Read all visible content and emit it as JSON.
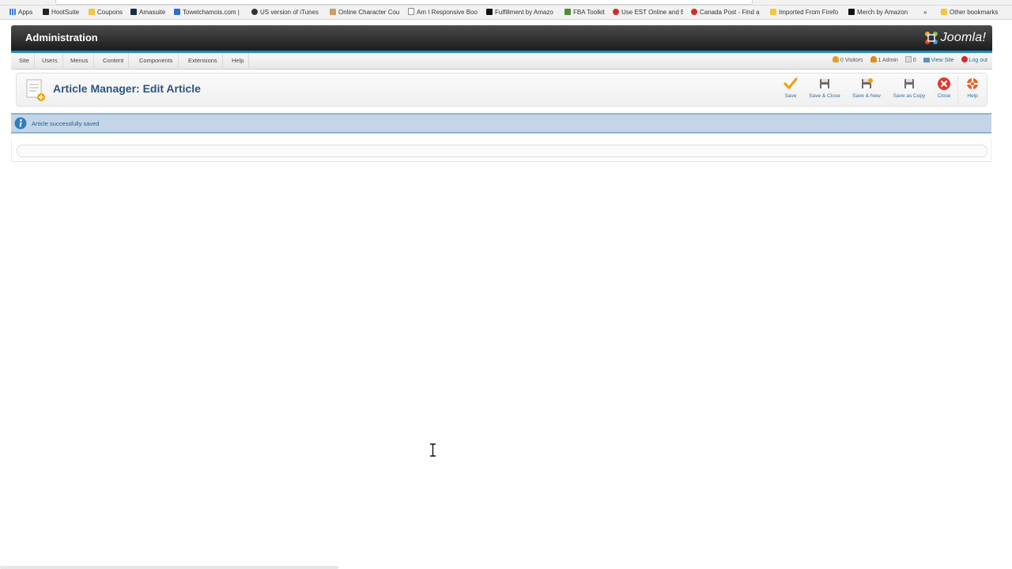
{
  "bookmarks": [
    {
      "label": "Apps",
      "color": "#3b7dd8"
    },
    {
      "label": "HootSuite",
      "color": "#222222"
    },
    {
      "label": "Coupons",
      "color": "#f4c542"
    },
    {
      "label": "Amasuite",
      "color": "#1a2b4c"
    },
    {
      "label": "Towelchamois.com |",
      "color": "#2a6fc9"
    },
    {
      "label": "US version of iTunes",
      "color": "#333333"
    },
    {
      "label": "Online Character Cou",
      "color": "#c8a060"
    },
    {
      "label": "Am I Responsive Boo",
      "color": "#888888"
    },
    {
      "label": "Fulfillment by Amazo",
      "color": "#111111"
    },
    {
      "label": "FBA Toolkit",
      "color": "#4a8f3c"
    },
    {
      "label": "Use EST Online and E",
      "color": "#d32a2a"
    },
    {
      "label": "Canada Post - Find a",
      "color": "#d32a2a"
    },
    {
      "label": "Imported From Firefo",
      "color": "#f4c542"
    },
    {
      "label": "Merch by Amazon",
      "color": "#111111"
    }
  ],
  "bookmarks_more": "»",
  "bookmarks_other": "Other bookmarks",
  "header": {
    "title": "Administration",
    "logo_text": "Joomla!"
  },
  "menu": [
    "Site",
    "Users",
    "Menus",
    "Content",
    "Components",
    "Extensions",
    "Help"
  ],
  "status": {
    "visitors": "0 Visitors",
    "admins": "1 Admin",
    "messages": "0",
    "view_site": "View Site",
    "logout": "Log out"
  },
  "toolbar": {
    "page_title": "Article Manager: Edit Article",
    "save": "Save",
    "save_close": "Save & Close",
    "save_new": "Save & New",
    "save_copy": "Save as Copy",
    "close": "Close",
    "help": "Help"
  },
  "message": {
    "text": "Article successfully saved"
  },
  "colors": {
    "header_bg": "#1c1c1c",
    "accent_blue": "#1d88c2",
    "title_blue": "#2c5580",
    "message_bg": "#c3d5e6",
    "close_red": "#e03a2e",
    "save_orange": "#f0a010"
  }
}
